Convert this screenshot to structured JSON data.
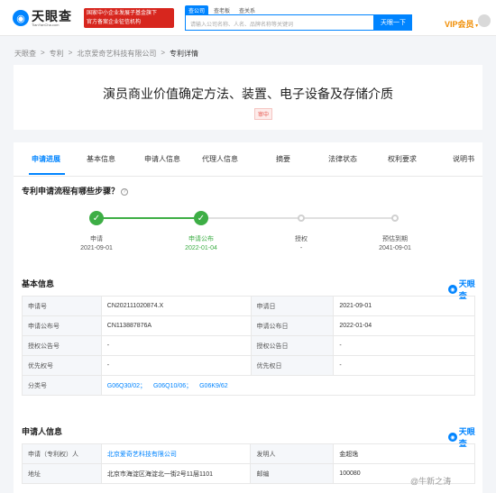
{
  "header": {
    "logo_text": "天眼查",
    "logo_sub": "TianYanCha.com",
    "promo_line1": "国家中小企业发展子基金旗下",
    "promo_line2": "官方备案企业征信机构",
    "search_tabs": [
      "查公司",
      "查老板",
      "查关系"
    ],
    "search_placeholder": "请输入公司名称、人名、品牌名称等关键词",
    "search_button": "天眼一下",
    "vip_label": "VIP会员"
  },
  "breadcrumb": [
    "天眼查",
    "专利",
    "北京爱奇艺科技有限公司",
    "专利详情"
  ],
  "patent": {
    "title": "演员商业价值确定方法、装置、电子设备及存储介质",
    "status": "审中"
  },
  "tabs": [
    "申请进展",
    "基本信息",
    "申请人信息",
    "代理人信息",
    "摘要",
    "法律状态",
    "权利要求",
    "说明书"
  ],
  "progress": {
    "heading": "专利申请流程有哪些步骤？",
    "steps": [
      {
        "label": "申请",
        "date": "2021-09-01",
        "done": true
      },
      {
        "label": "申请公布",
        "date": "2022-01-04",
        "done": true
      },
      {
        "label": "授权",
        "date": "-",
        "done": false
      },
      {
        "label": "预估到期",
        "date": "2041-09-01",
        "done": false
      }
    ]
  },
  "basic_info": {
    "heading": "基本信息",
    "brand": "天眼查",
    "rows": [
      {
        "l1": "申请号",
        "v1": "CN202111020874.X",
        "l2": "申请日",
        "v2": "2021-09-01"
      },
      {
        "l1": "申请公布号",
        "v1": "CN113887876A",
        "l2": "申请公布日",
        "v2": "2022-01-04"
      },
      {
        "l1": "授权公告号",
        "v1": "-",
        "l2": "授权公告日",
        "v2": "-"
      },
      {
        "l1": "优先权号",
        "v1": "-",
        "l2": "优先权日",
        "v2": "-"
      }
    ],
    "class_label": "分类号",
    "classes": [
      "G06Q30/02；",
      "G06Q10/06；",
      "G06K9/62"
    ]
  },
  "applicant_info": {
    "heading": "申请人信息",
    "brand": "天眼查",
    "rows": [
      {
        "l1": "申请（专利权）人",
        "v1": "北京爱奇艺科技有限公司",
        "l2": "发明人",
        "v2": "金超逸"
      },
      {
        "l1": "地址",
        "v1": "北京市海淀区海淀北一街2号11层1101",
        "l2": "邮编",
        "v2": "100080"
      }
    ]
  },
  "watermark": "@牛新之涛"
}
